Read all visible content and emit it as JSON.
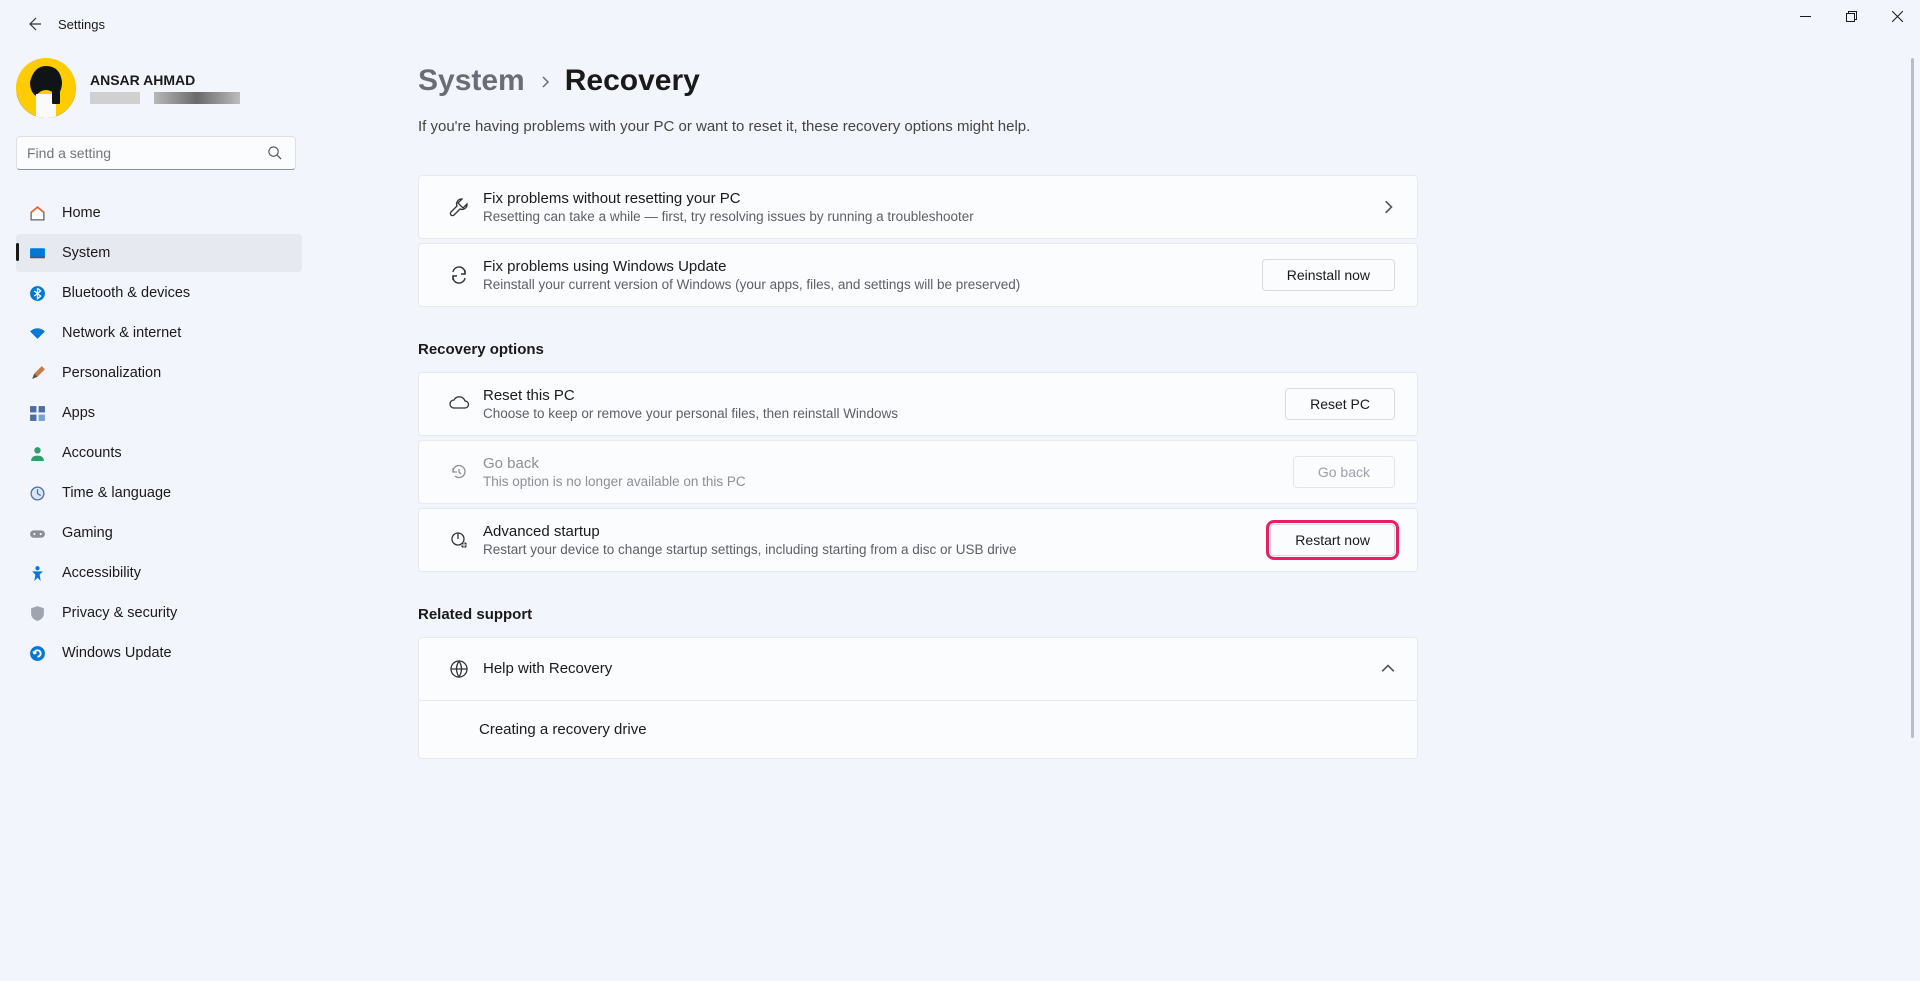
{
  "window": {
    "title": "Settings"
  },
  "user": {
    "name": "ANSAR AHMAD"
  },
  "search": {
    "placeholder": "Find a setting"
  },
  "sidebar": {
    "items": [
      {
        "label": "Home"
      },
      {
        "label": "System"
      },
      {
        "label": "Bluetooth & devices"
      },
      {
        "label": "Network & internet"
      },
      {
        "label": "Personalization"
      },
      {
        "label": "Apps"
      },
      {
        "label": "Accounts"
      },
      {
        "label": "Time & language"
      },
      {
        "label": "Gaming"
      },
      {
        "label": "Accessibility"
      },
      {
        "label": "Privacy & security"
      },
      {
        "label": "Windows Update"
      }
    ],
    "active_index": 1
  },
  "breadcrumb": {
    "parent": "System",
    "current": "Recovery"
  },
  "intro": "If you're having problems with your PC or want to reset it, these recovery options might help.",
  "cards_top": [
    {
      "title": "Fix problems without resetting your PC",
      "sub": "Resetting can take a while — first, try resolving issues by running a troubleshooter",
      "action_type": "chevron"
    },
    {
      "title": "Fix problems using Windows Update",
      "sub": "Reinstall your current version of Windows (your apps, files, and settings will be preserved)",
      "action_type": "button",
      "action_label": "Reinstall now"
    }
  ],
  "sections": {
    "recovery_options": {
      "title": "Recovery options",
      "cards": [
        {
          "title": "Reset this PC",
          "sub": "Choose to keep or remove your personal files, then reinstall Windows",
          "action_label": "Reset PC",
          "disabled": false
        },
        {
          "title": "Go back",
          "sub": "This option is no longer available on this PC",
          "action_label": "Go back",
          "disabled": true
        },
        {
          "title": "Advanced startup",
          "sub": "Restart your device to change startup settings, including starting from a disc or USB drive",
          "action_label": "Restart now",
          "disabled": false,
          "highlighted": true
        }
      ]
    },
    "related_support": {
      "title": "Related support",
      "expand_title": "Help with Recovery",
      "subitem": "Creating a recovery drive"
    }
  }
}
